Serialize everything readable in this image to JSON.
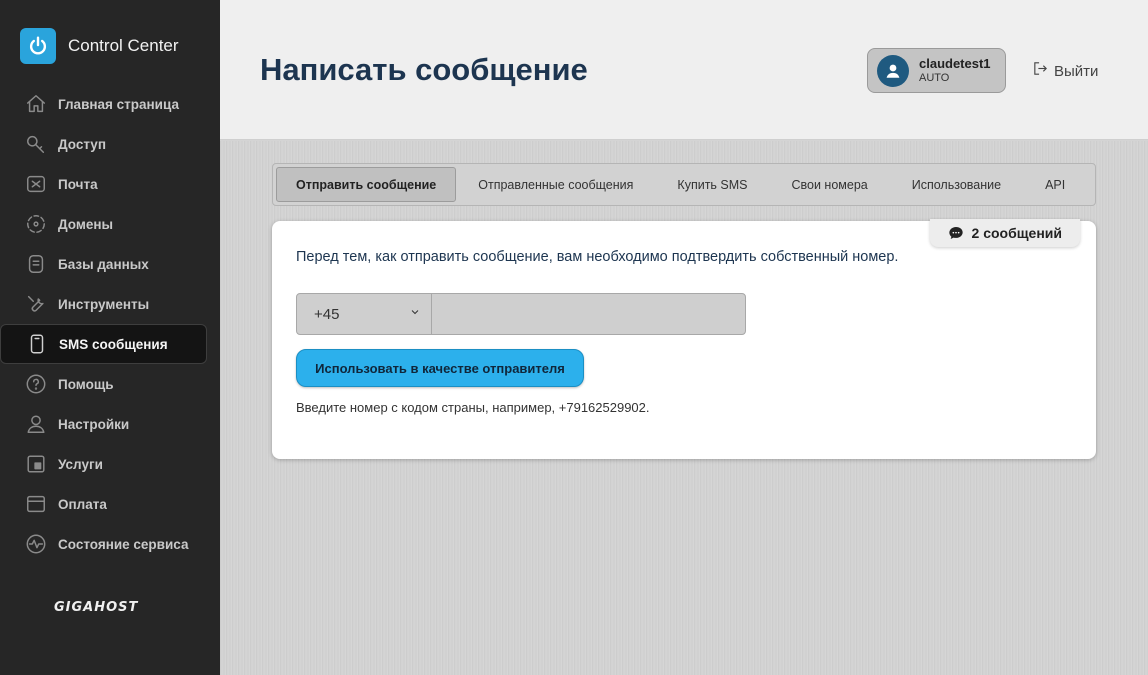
{
  "app": {
    "title": "Control Center",
    "footer_logo": "GIGAHOST"
  },
  "sidebar": {
    "items": [
      {
        "label": "Главная страница",
        "icon": "home-icon"
      },
      {
        "label": "Доступ",
        "icon": "key-icon"
      },
      {
        "label": "Почта",
        "icon": "mail-icon"
      },
      {
        "label": "Домены",
        "icon": "globe-icon"
      },
      {
        "label": "Базы данных",
        "icon": "database-icon"
      },
      {
        "label": "Инструменты",
        "icon": "wrench-icon"
      },
      {
        "label": "SMS сообщения",
        "icon": "phone-icon",
        "active": true
      },
      {
        "label": "Помощь",
        "icon": "help-icon"
      },
      {
        "label": "Настройки",
        "icon": "user-icon"
      },
      {
        "label": "Услуги",
        "icon": "services-icon"
      },
      {
        "label": "Оплата",
        "icon": "card-icon"
      },
      {
        "label": "Состояние сервиса",
        "icon": "activity-icon"
      }
    ]
  },
  "header": {
    "title": "Написать сообщение",
    "user": {
      "name": "claudetest1",
      "role": "AUTO"
    },
    "logout_label": "Выйти"
  },
  "tabs": [
    {
      "label": "Отправить сообщение",
      "active": true
    },
    {
      "label": "Отправленные сообщения"
    },
    {
      "label": "Купить SMS"
    },
    {
      "label": "Свои номера"
    },
    {
      "label": "Использование"
    },
    {
      "label": "API"
    }
  ],
  "card": {
    "badge": "2 сообщений",
    "intro": "Перед тем, как отправить сообщение, вам необходимо подтвердить собственный номер.",
    "country_code": "+45",
    "phone_value": "",
    "button_label": "Использовать в качестве отправителя",
    "hint": "Введите номер с кодом страны, например, +79162529902."
  },
  "colors": {
    "sidebar_bg": "#262626",
    "accent": "#2cb0ec",
    "title": "#1d3550",
    "avatar": "#1f5a80"
  }
}
